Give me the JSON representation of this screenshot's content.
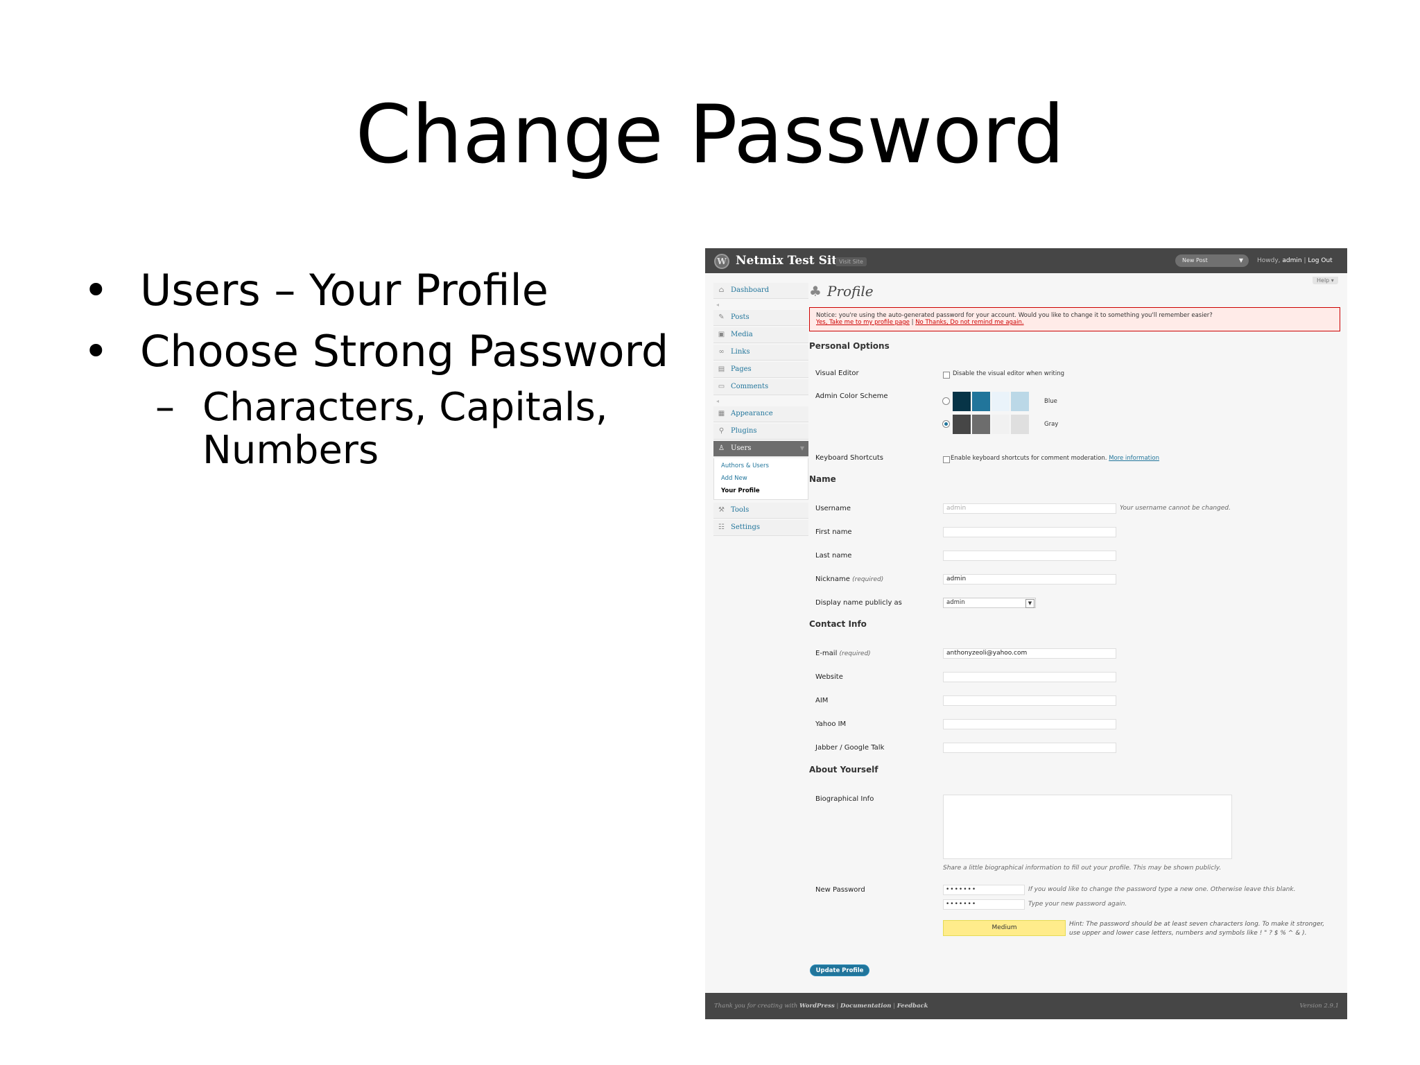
{
  "slide": {
    "title": "Change Password",
    "bullets": [
      "Users – Your Profile",
      "Choose Strong Password"
    ],
    "sub_bullet": "Characters, Capitals, Numbers"
  },
  "header": {
    "site_title": "Netmix Test Site",
    "visit_site": "Visit Site",
    "new_post": "New Post",
    "howdy": "Howdy,",
    "user": "admin",
    "separator": "|",
    "logout": "Log Out",
    "help": "Help ▾"
  },
  "menu": {
    "dashboard": "Dashboard",
    "posts": "Posts",
    "media": "Media",
    "links": "Links",
    "pages": "Pages",
    "comments": "Comments",
    "appearance": "Appearance",
    "plugins": "Plugins",
    "users": "Users",
    "users_sub": [
      "Authors & Users",
      "Add New",
      "Your Profile"
    ],
    "tools": "Tools",
    "settings": "Settings"
  },
  "page": {
    "title": "Profile",
    "notice_text": "Notice: you're using the auto-generated password for your account. Would you like to change it to something you'll remember easier?",
    "notice_link1": "Yes, Take me to my profile page",
    "notice_sep": "|",
    "notice_link2": "No Thanks, Do not remind me again."
  },
  "personal_options": {
    "heading": "Personal Options",
    "visual_editor_label": "Visual Editor",
    "visual_editor_text": "Disable the visual editor when writing",
    "color_scheme_label": "Admin Color Scheme",
    "scheme_blue": "Blue",
    "scheme_gray": "Gray",
    "blue_colors": [
      "#073447",
      "#21759b",
      "#eaf3fa",
      "#bbd8e7"
    ],
    "gray_colors": [
      "#464646",
      "#6d6d6d",
      "#f1f1f1",
      "#dfdfdf"
    ],
    "keyboard_label": "Keyboard Shortcuts",
    "keyboard_text": "Enable keyboard shortcuts for comment moderation.",
    "keyboard_link": "More information"
  },
  "name": {
    "heading": "Name",
    "username_label": "Username",
    "username_value": "admin",
    "username_hint": "Your username cannot be changed.",
    "first_label": "First name",
    "first_value": "",
    "last_label": "Last name",
    "last_value": "",
    "nickname_label": "Nickname",
    "required": "(required)",
    "nickname_value": "admin",
    "display_label": "Display name publicly as",
    "display_value": "admin"
  },
  "contact": {
    "heading": "Contact Info",
    "email_label": "E-mail",
    "required": "(required)",
    "email_value": "anthonyzeoli@yahoo.com",
    "website_label": "Website",
    "aim_label": "AIM",
    "yahoo_label": "Yahoo IM",
    "jabber_label": "Jabber / Google Talk"
  },
  "about": {
    "heading": "About Yourself",
    "bio_label": "Biographical Info",
    "bio_hint": "Share a little biographical information to fill out your profile. This may be shown publicly.",
    "pw_label": "New Password",
    "pw1_value": "•••••••",
    "pw1_hint": "If you would like to change the password type a new one. Otherwise leave this blank.",
    "pw2_value": "•••••••",
    "pw2_hint": "Type your new password again.",
    "strength": "Medium",
    "pw_hint": "Hint: The password should be at least seven characters long. To make it stronger, use upper and lower case letters, numbers and symbols like ! \" ? $ % ^ & )."
  },
  "actions": {
    "update": "Update Profile"
  },
  "footer": {
    "thanks": "Thank you for creating with",
    "wordpress": "WordPress",
    "sep": "|",
    "docs": "Documentation",
    "feedback": "Feedback",
    "version": "Version 2.9.1"
  }
}
